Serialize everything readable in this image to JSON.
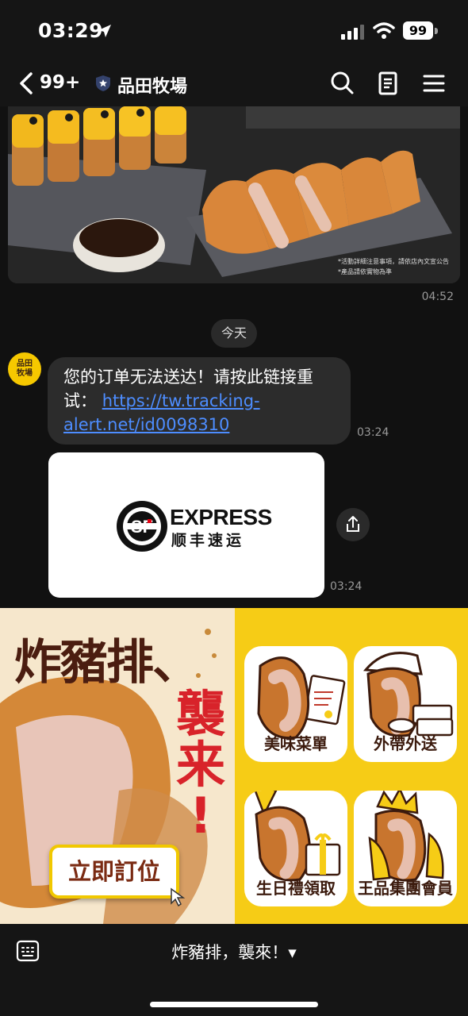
{
  "status_bar": {
    "time": "03:29",
    "battery": "99"
  },
  "header": {
    "unread_count": "99+",
    "title": "品田牧場"
  },
  "top_image": {
    "fine_print_1": "*活動詳細注意事項，請依店內文宣公告",
    "fine_print_2": "*產品請依實物為準",
    "timestamp": "04:52"
  },
  "date_separator": "今天",
  "message": {
    "avatar_text_1": "品田",
    "avatar_text_2": "牧場",
    "text": "您的订单无法送达！请按此链接重试：",
    "link": "https://tw.tracking-alert.net/id0098310",
    "timestamp": "03:24"
  },
  "image_card": {
    "brand_en": "EXPRESS",
    "brand_cn": "顺丰速运",
    "logo_text": "SF",
    "timestamp": "03:24"
  },
  "rich_menu": {
    "promo_line1": "炸豬排、",
    "promo_line2": [
      "襲",
      "来",
      "!"
    ],
    "order_button": "立即訂位",
    "tiles": [
      {
        "label": "美味菜單"
      },
      {
        "label": "外帶外送"
      },
      {
        "label": "生日禮領取"
      },
      {
        "label": "王品集團會員"
      }
    ]
  },
  "bottom_bar": {
    "menu_toggle": "炸豬排，襲來！▾"
  },
  "colors": {
    "accent_yellow": "#f6cc16",
    "link_blue": "#4d8dff",
    "promo_red": "#d8232a",
    "bubble_bg": "#2c2c2c"
  }
}
